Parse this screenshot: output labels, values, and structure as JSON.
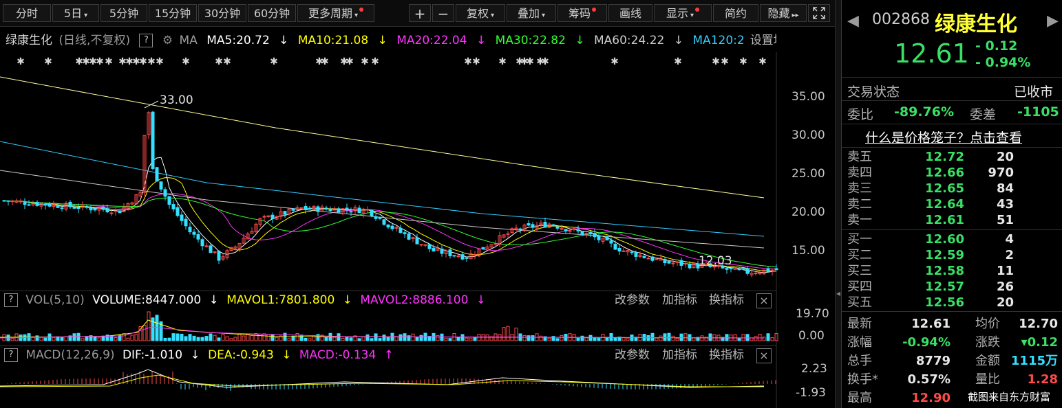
{
  "toolbar": {
    "periods": [
      "分时",
      "5日",
      "5分钟",
      "15分钟",
      "30分钟",
      "60分钟",
      "更多周期"
    ],
    "tools": [
      "+",
      "−",
      "复权",
      "叠加",
      "筹码",
      "画线",
      "显示",
      "简约",
      "隐藏"
    ]
  },
  "legend": {
    "name": "绿康生化",
    "mode": "(日线,不复权)",
    "help": "?",
    "ma_label": "MA",
    "ma5": "MA5:20.72",
    "ma10": "MA10:21.08",
    "ma20": "MA20:22.04",
    "ma30": "MA30:22.82",
    "ma60": "MA60:24.22",
    "ma120": "MA120:2",
    "settings": "设置均线"
  },
  "annotations": {
    "high": "33.00",
    "low": "12.03"
  },
  "price_axis": [
    "35.00",
    "30.00",
    "25.00",
    "20.00",
    "15.00"
  ],
  "volume_panel": {
    "help": "?",
    "title": "VOL(5,10)",
    "volume": "VOLUME:8447.000",
    "mavol1": "MAVOL1:7801.800",
    "mavol2": "MAVOL2:8886.100",
    "axis_top": "19.70",
    "axis_bottom": "0.00",
    "btn_params": "改参数",
    "btn_add": "加指标",
    "btn_switch": "换指标",
    "close": "×"
  },
  "macd_panel": {
    "help": "?",
    "title": "MACD(12,26,9)",
    "dif": "DIF:-1.010",
    "dea": "DEA:-0.943",
    "macd": "MACD:-0.134",
    "axis_top": "2.23",
    "axis_bottom": "-1.93",
    "btn_params": "改参数",
    "btn_add": "加指标",
    "btn_switch": "换指标",
    "close": "×"
  },
  "quote": {
    "code": "002868",
    "name": "绿康生化",
    "price": "12.61",
    "change": "- 0.12",
    "change_pct": "- 0.94%",
    "status_label": "交易状态",
    "status_value": "已收市",
    "weibi_label": "委比",
    "weibi_value": "-89.76%",
    "weicha_label": "委差",
    "weicha_value": "-1105",
    "cage_link": "什么是价格笼子？点击查看",
    "asks": [
      {
        "label": "卖五",
        "price": "12.72",
        "vol": "20"
      },
      {
        "label": "卖四",
        "price": "12.66",
        "vol": "970"
      },
      {
        "label": "卖三",
        "price": "12.65",
        "vol": "84"
      },
      {
        "label": "卖二",
        "price": "12.64",
        "vol": "43"
      },
      {
        "label": "卖一",
        "price": "12.61",
        "vol": "51"
      }
    ],
    "bids": [
      {
        "label": "买一",
        "price": "12.60",
        "vol": "4"
      },
      {
        "label": "买二",
        "price": "12.59",
        "vol": "2"
      },
      {
        "label": "买三",
        "price": "12.58",
        "vol": "11"
      },
      {
        "label": "买四",
        "price": "12.57",
        "vol": "26"
      },
      {
        "label": "买五",
        "price": "12.56",
        "vol": "20"
      }
    ],
    "stats": [
      {
        "l1": "最新",
        "v1": "12.61",
        "l2": "均价",
        "v2": "12.70"
      },
      {
        "l1": "涨幅",
        "v1": "-0.94%",
        "l2": "涨跌",
        "v2": "▾0.12"
      },
      {
        "l1": "总手",
        "v1": "8779",
        "l2": "金额",
        "v2": "1115万"
      },
      {
        "l1": "换手*",
        "v1": "0.57%",
        "l2": "量比",
        "v2": "1.28"
      },
      {
        "l1": "最高",
        "v1": "12.90",
        "l2": "",
        "v2": ""
      }
    ]
  },
  "watermark": "截图来自东方财富",
  "colors": {
    "up": "#ff4a4a",
    "down": "#33e0ff",
    "green": "#3ae066",
    "ma5": "#ffffff",
    "ma10": "#ffff00",
    "ma20": "#ff33ff",
    "ma30": "#33ff33",
    "ma60": "#cccccc",
    "ma120": "#33ccff"
  }
}
